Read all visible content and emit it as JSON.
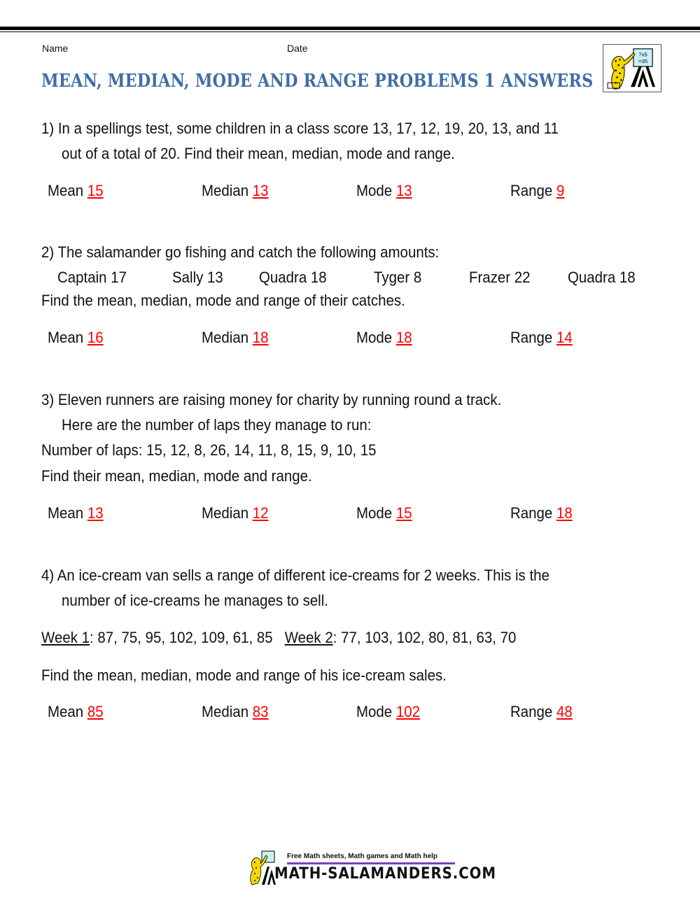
{
  "header": {
    "name_label": "Name",
    "date_label": "Date",
    "title": "MEAN, MEDIAN, MODE AND RANGE PROBLEMS 1 ANSWERS",
    "logo_icon": "salamander-teacher-logo-icon",
    "logo_board_text": [
      "7x5",
      "=35"
    ]
  },
  "colors": {
    "title": "#3f6ea5",
    "answer": "#ff0000",
    "footer_rule": "#7b3fbf"
  },
  "problems": [
    {
      "lines": [
        "1) In a spellings test, some children in a class score 13, 17, 12, 19, 20, 13, and 11",
        "out of a total of 20. Find their mean, median, mode and range."
      ],
      "answers": {
        "mean_label": "Mean",
        "mean": "15",
        "median_label": "Median",
        "median": "13",
        "mode_label": "Mode",
        "mode": "13",
        "range_label": "Range",
        "range": "9"
      }
    },
    {
      "lines": [
        "2) The salamander go fishing and catch the following amounts:",
        "Find the mean, median, mode and range of their catches."
      ],
      "catches": [
        "Captain 17",
        "Sally 13",
        "Quadra 18",
        "Tyger 8",
        "Frazer 22",
        "Quadra 18"
      ],
      "answers": {
        "mean_label": "Mean",
        "mean": "16",
        "median_label": "Median",
        "median": "18",
        "mode_label": "Mode",
        "mode": "18",
        "range_label": "Range",
        "range": "14"
      }
    },
    {
      "lines": [
        "3) Eleven runners are raising money for charity by running round a track.",
        "Here are the number of laps they manage to run:",
        "Number of laps: 15, 12, 8, 26, 14, 11, 8, 15, 9, 10, 15",
        "Find their mean, median, mode and range."
      ],
      "answers": {
        "mean_label": "Mean",
        "mean": "13",
        "median_label": "Median",
        "median": "12",
        "mode_label": "Mode",
        "mode": "15",
        "range_label": "Range",
        "range": "18"
      }
    },
    {
      "lines": [
        "4) An ice-cream van sells a range of different ice-creams for 2 weeks. This is the",
        "number of ice-creams he manages to sell.",
        "Find the mean, median, mode and range of his ice-cream sales."
      ],
      "week1_label": "Week 1",
      "week1_values": ": 87, 75, 95, 102, 109, 61, 85",
      "week2_label": "Week 2",
      "week2_values": ": 77, 103, 102, 80, 81, 63, 70",
      "answers": {
        "mean_label": "Mean",
        "mean": "85",
        "median_label": "Median",
        "median": "83",
        "mode_label": "Mode",
        "mode": "102",
        "range_label": "Range",
        "range": "48"
      }
    }
  ],
  "footer": {
    "tagline": "Free Math sheets, Math games and Math help",
    "site": "MATH-SALAMANDERS.COM"
  }
}
